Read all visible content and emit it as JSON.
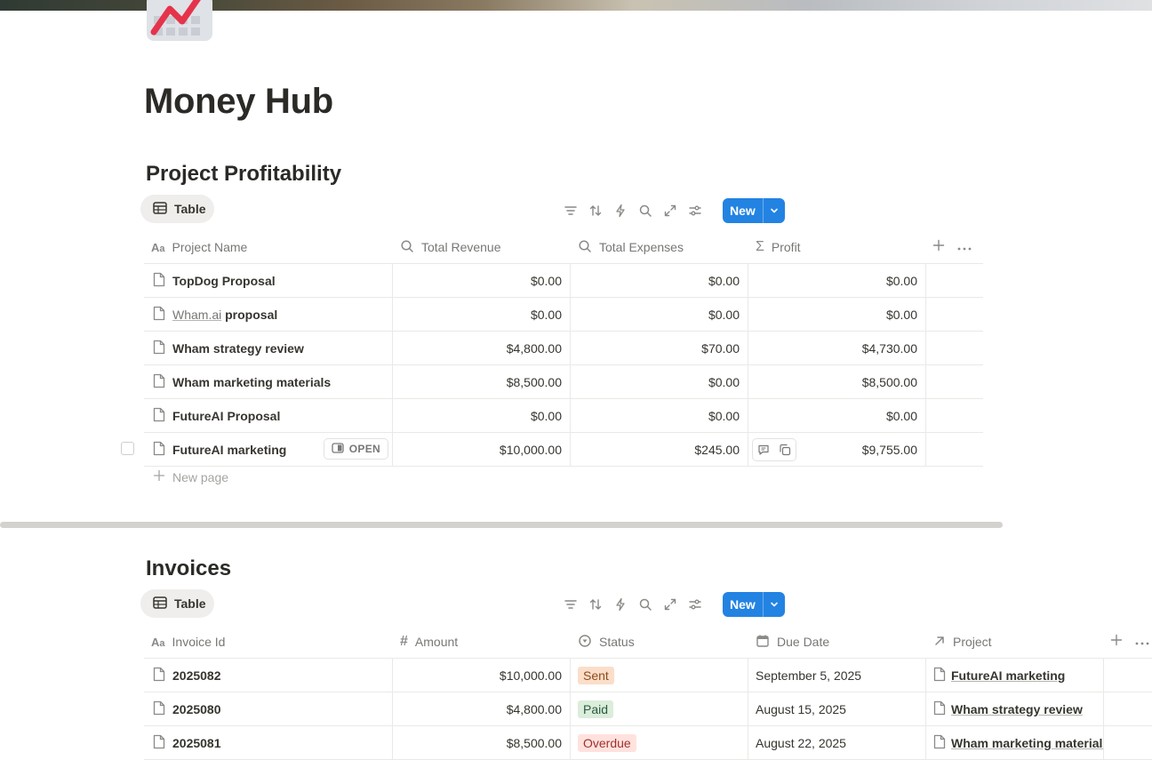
{
  "page": {
    "title": "Money Hub"
  },
  "icons": {
    "page_icon": "chart-increasing-icon"
  },
  "colors": {
    "accent": "#2383e2",
    "sent_bg": "#fadec9",
    "sent_fg": "#8f4b1d",
    "paid_bg": "#dbeddb",
    "paid_fg": "#2b593f",
    "overdue_bg": "#ffe2dd",
    "overdue_fg": "#9f2f2d"
  },
  "profitability": {
    "title": "Project Profitability",
    "view_tab": "Table",
    "new_label": "New",
    "columns": [
      "Project Name",
      "Total Revenue",
      "Total Expenses",
      "Profit"
    ],
    "rows": [
      {
        "name": "TopDog Proposal",
        "revenue": "$0.00",
        "expenses": "$0.00",
        "profit": "$0.00"
      },
      {
        "name_link": "Wham.ai",
        "name_rest": " proposal",
        "revenue": "$0.00",
        "expenses": "$0.00",
        "profit": "$0.00"
      },
      {
        "name": "Wham strategy review",
        "revenue": "$4,800.00",
        "expenses": "$70.00",
        "profit": "$4,730.00"
      },
      {
        "name": "Wham marketing materials",
        "revenue": "$8,500.00",
        "expenses": "$0.00",
        "profit": "$8,500.00"
      },
      {
        "name": "FutureAI Proposal",
        "revenue": "$0.00",
        "expenses": "$0.00",
        "profit": "$0.00"
      },
      {
        "name": "FutureAI marketing",
        "revenue": "$10,000.00",
        "expenses": "$245.00",
        "profit": "$9,755.00",
        "open_label": "OPEN"
      }
    ],
    "new_page_label": "New page"
  },
  "invoices": {
    "title": "Invoices",
    "view_tab": "Table",
    "new_label": "New",
    "columns": [
      "Invoice Id",
      "Amount",
      "Status",
      "Due Date",
      "Project"
    ],
    "rows": [
      {
        "id": "2025082",
        "amount": "$10,000.00",
        "status": "Sent",
        "due": "September 5, 2025",
        "project": "FutureAI marketing"
      },
      {
        "id": "2025080",
        "amount": "$4,800.00",
        "status": "Paid",
        "due": "August 15, 2025",
        "project": "Wham strategy review"
      },
      {
        "id": "2025081",
        "amount": "$8,500.00",
        "status": "Overdue",
        "due": "August 22, 2025",
        "project": "Wham marketing materials"
      }
    ]
  }
}
